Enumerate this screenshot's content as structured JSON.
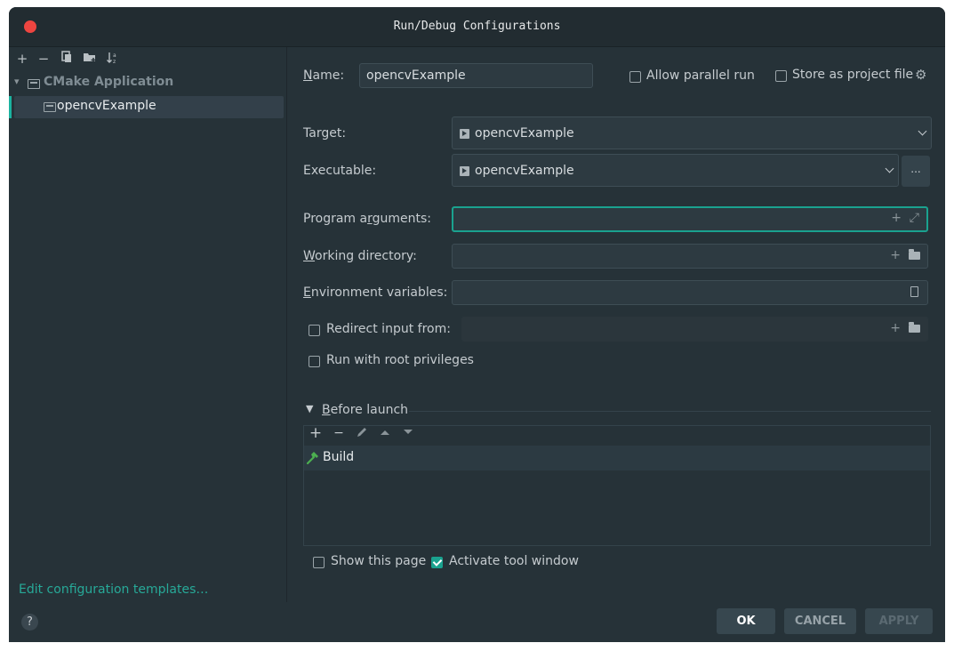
{
  "window": {
    "title": "Run/Debug Configurations"
  },
  "left": {
    "toolbar": [
      "add-icon",
      "remove-icon",
      "copy-icon",
      "folder-add-icon",
      "sort-icon"
    ],
    "group": {
      "label": "CMake Application"
    },
    "item": {
      "label": "opencvExample"
    },
    "edit_templates": "Edit configuration templates…"
  },
  "form": {
    "name": {
      "label": "Name:",
      "value": "opencvExample"
    },
    "allow_parallel": {
      "label": "Allow parallel run",
      "checked": false
    },
    "store_project": {
      "label": "Store as project file",
      "checked": false
    },
    "target": {
      "label": "Target:",
      "value": "opencvExample"
    },
    "executable": {
      "label": "Executable:",
      "value": "opencvExample",
      "browse": "..."
    },
    "program_args": {
      "label": "Program arguments:",
      "value": ""
    },
    "working_dir": {
      "label": "Working directory:",
      "value": ""
    },
    "env_vars": {
      "label": "Environment variables:",
      "value": ""
    },
    "redirect": {
      "label": "Redirect input from:",
      "checked": false,
      "value": ""
    },
    "root": {
      "label": "Run with root privileges",
      "checked": false
    }
  },
  "before_launch": {
    "label": "Before launch",
    "tasks": [
      {
        "label": "Build"
      }
    ]
  },
  "options": {
    "show_page": {
      "label": "Show this page",
      "checked": false
    },
    "activate_tool": {
      "label": "Activate tool window",
      "checked": true
    }
  },
  "buttons": {
    "help": "?",
    "ok": "OK",
    "cancel": "CANCEL",
    "apply": "APPLY"
  },
  "colors": {
    "accent": "#1aa28f",
    "background": "#263238",
    "close": "#ee4540"
  }
}
